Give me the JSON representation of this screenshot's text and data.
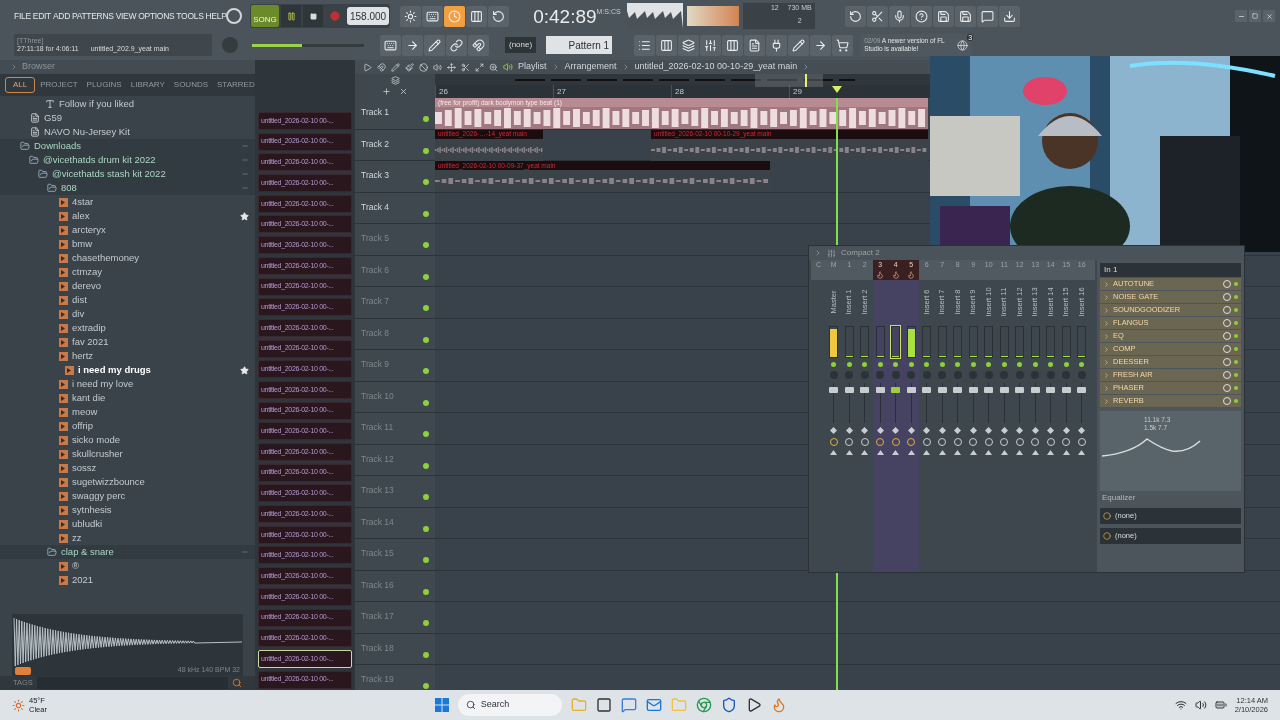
{
  "menu": [
    "FILE",
    "EDIT",
    "ADD",
    "PATTERNS",
    "VIEW",
    "OPTIONS",
    "TOOLS",
    "HELP"
  ],
  "hint": {
    "title": "[TThree]",
    "time": "27:11:18 for 4:06:11",
    "project": "untitled_202.9_yeat main"
  },
  "transport": {
    "mode": "SONG",
    "song_mode": true,
    "playing": true,
    "recording": false,
    "tempo": "158.000",
    "time": "0:42:89",
    "time_unit": "M:S:CS",
    "master_volume": {
      "level": 0.45
    }
  },
  "cpu": {
    "voices": "12",
    "memory": "730 MB",
    "poly": "2"
  },
  "pattern": {
    "snap": "(none)",
    "name": "Pattern 1"
  },
  "news": {
    "date": "02/09",
    "text": "A newer version of FL Studio is available!",
    "count": "3"
  },
  "browser": {
    "title": "Browser",
    "tabs": [
      {
        "label": "ALL",
        "selected": true
      },
      {
        "label": "PROJECT",
        "selected": false
      },
      {
        "label": "PLUGINS",
        "selected": false
      },
      {
        "label": "LIBRARY",
        "selected": false
      },
      {
        "label": "SOUNDS",
        "selected": false
      },
      {
        "label": "STARRED",
        "selected": false
      }
    ],
    "tree": [
      {
        "label": "Follow if you liked",
        "kind": "text"
      },
      {
        "label": "G59",
        "kind": "file"
      },
      {
        "label": "NAVO Nu-Jersey Kit",
        "kind": "file"
      },
      {
        "label": "Downloads",
        "kind": "folder",
        "expanded": true,
        "children": [
          {
            "label": "@vicethatds drum kit 2022",
            "kind": "folder",
            "expanded": true,
            "children": [
              {
                "label": "@vicethatds stash kit 2022",
                "kind": "folder",
                "expanded": true,
                "children": [
                  {
                    "label": "808",
                    "kind": "folder",
                    "expanded": true,
                    "children": [
                      {
                        "label": "4star",
                        "kind": "sample",
                        "selected": false,
                        "starred": false
                      },
                      {
                        "label": "alex",
                        "kind": "sample",
                        "selected": false,
                        "starred": true
                      },
                      {
                        "label": "arcteryx",
                        "kind": "sample",
                        "selected": false,
                        "starred": false
                      },
                      {
                        "label": "bmw",
                        "kind": "sample",
                        "selected": false,
                        "starred": false
                      },
                      {
                        "label": "chasethemoney",
                        "kind": "sample",
                        "selected": false,
                        "starred": false
                      },
                      {
                        "label": "ctmzay",
                        "kind": "sample",
                        "selected": false,
                        "starred": false
                      },
                      {
                        "label": "derevo",
                        "kind": "sample",
                        "selected": false,
                        "starred": false
                      },
                      {
                        "label": "dist",
                        "kind": "sample",
                        "selected": false,
                        "starred": false
                      },
                      {
                        "label": "div",
                        "kind": "sample",
                        "selected": false,
                        "starred": false
                      },
                      {
                        "label": "extradip",
                        "kind": "sample",
                        "selected": false,
                        "starred": false
                      },
                      {
                        "label": "fav 2021",
                        "kind": "sample",
                        "selected": false,
                        "starred": false
                      },
                      {
                        "label": "hertz",
                        "kind": "sample",
                        "selected": false,
                        "starred": false
                      },
                      {
                        "label": "i need my drugs",
                        "kind": "sample",
                        "selected": true,
                        "starred": true
                      },
                      {
                        "label": "i need my love",
                        "kind": "sample",
                        "selected": false,
                        "starred": false
                      },
                      {
                        "label": "kant die",
                        "kind": "sample",
                        "selected": false,
                        "starred": false
                      },
                      {
                        "label": "meow",
                        "kind": "sample",
                        "selected": false,
                        "starred": false
                      },
                      {
                        "label": "offrip",
                        "kind": "sample",
                        "selected": false,
                        "starred": false
                      },
                      {
                        "label": "sicko mode",
                        "kind": "sample",
                        "selected": false,
                        "starred": false
                      },
                      {
                        "label": "skullcrusher",
                        "kind": "sample",
                        "selected": false,
                        "starred": false
                      },
                      {
                        "label": "sossz",
                        "kind": "sample",
                        "selected": false,
                        "starred": false
                      },
                      {
                        "label": "sugetwizzbounce",
                        "kind": "sample",
                        "selected": false,
                        "starred": false
                      },
                      {
                        "label": "swaggy perc",
                        "kind": "sample",
                        "selected": false,
                        "starred": false
                      },
                      {
                        "label": "sytnhesis",
                        "kind": "sample",
                        "selected": false,
                        "starred": false
                      },
                      {
                        "label": "ubludki",
                        "kind": "sample",
                        "selected": false,
                        "starred": false
                      },
                      {
                        "label": "zz",
                        "kind": "sample",
                        "selected": false,
                        "starred": false
                      }
                    ]
                  },
                  {
                    "label": "clap & snare",
                    "kind": "folder",
                    "expanded": true,
                    "children": [
                      {
                        "label": "®",
                        "kind": "sample",
                        "selected": false,
                        "starred": false
                      },
                      {
                        "label": "2021",
                        "kind": "sample",
                        "selected": false,
                        "starred": false
                      }
                    ]
                  }
                ]
              }
            ]
          }
        ]
      }
    ],
    "sample_info": "48 kHz 140 BPM 32",
    "tags_label": "TAGS"
  },
  "clips": [
    {
      "label": "untitled_2026-02-10 00-...",
      "selected": false
    },
    {
      "label": "untitled_2026-02-10 00-...",
      "selected": false
    },
    {
      "label": "untitled_2026-02-10 00-...",
      "selected": false
    },
    {
      "label": "untitled_2026-02-10 00-...",
      "selected": false
    },
    {
      "label": "untitled_2026-02-10 00-...",
      "selected": false
    },
    {
      "label": "untitled_2026-02-10 00-...",
      "selected": false
    },
    {
      "label": "untitled_2026-02-10 00-...",
      "selected": false
    },
    {
      "label": "untitled_2026-02-10 00-...",
      "selected": false
    },
    {
      "label": "untitled_2026-02-10 00-...",
      "selected": false
    },
    {
      "label": "untitled_2026-02-10 00-...",
      "selected": false
    },
    {
      "label": "untitled_2026-02-10 00-...",
      "selected": false
    },
    {
      "label": "untitled_2026-02-10 00-...",
      "selected": false
    },
    {
      "label": "untitled_2026-02-10 00-...",
      "selected": false
    },
    {
      "label": "untitled_2026-02-10 00-...",
      "selected": false
    },
    {
      "label": "untitled_2026-02-10 00-...",
      "selected": false
    },
    {
      "label": "untitled_2026-02-10 00-...",
      "selected": false
    },
    {
      "label": "untitled_2026-02-10 00-...",
      "selected": false
    },
    {
      "label": "untitled_2026-02-10 00-...",
      "selected": false
    },
    {
      "label": "untitled_2026-02-10 00-...",
      "selected": false
    },
    {
      "label": "untitled_2026-02-10 00-...",
      "selected": false
    },
    {
      "label": "untitled_2026-02-10 00-...",
      "selected": false
    },
    {
      "label": "untitled_2026-02-10 00-...",
      "selected": false
    },
    {
      "label": "untitled_2026-02-10 00-...",
      "selected": false
    },
    {
      "label": "untitled_2026-02-10 00-...",
      "selected": false
    },
    {
      "label": "untitled_2026-02-10 00-...",
      "selected": false
    },
    {
      "label": "untitled_2026-02-10 00-...",
      "selected": false
    },
    {
      "label": "untitled_2026-02-10 00-...",
      "selected": true
    },
    {
      "label": "untitled_2026-02-10 00-...",
      "selected": false
    }
  ],
  "playlist": {
    "title": "Playlist",
    "section": "Arrangement",
    "project": "untitled_2026-02-10 00-10-29_yeat main",
    "ruler": [
      "26",
      "27",
      "28",
      "29"
    ],
    "tracks": [
      {
        "name": "Track 1",
        "clips": [
          {
            "label": "(free for profit) dark boolymon type beat (1)",
            "kind": "audio"
          }
        ]
      },
      {
        "name": "Track 2",
        "clips": [
          {
            "label": "untitled_2026-…-14_yeat main",
            "kind": "take"
          },
          {
            "label": "untitled_2026-02-10 00-10-29_yeat main",
            "kind": "take"
          }
        ]
      },
      {
        "name": "Track 3",
        "clips": [
          {
            "label": "untitled_2026-02-10 00-09-37_yeat main",
            "kind": "take"
          }
        ]
      },
      {
        "name": "Track 4"
      },
      {
        "name": "Track 5"
      },
      {
        "name": "Track 6"
      },
      {
        "name": "Track 7"
      },
      {
        "name": "Track 8"
      },
      {
        "name": "Track 9"
      },
      {
        "name": "Track 10"
      },
      {
        "name": "Track 11"
      },
      {
        "name": "Track 12"
      },
      {
        "name": "Track 13"
      },
      {
        "name": "Track 14"
      },
      {
        "name": "Track 15"
      },
      {
        "name": "Track 16"
      },
      {
        "name": "Track 17"
      },
      {
        "name": "Track 18"
      },
      {
        "name": "Track 19"
      }
    ]
  },
  "mixer": {
    "title": "Compact 2",
    "current_column": "C",
    "strips": [
      {
        "number": "M",
        "label": "Master",
        "selected": false,
        "level": 0.9
      },
      {
        "number": "1",
        "label": "Insert 1",
        "selected": false,
        "level": 0
      },
      {
        "number": "2",
        "label": "Insert 2",
        "selected": false,
        "level": 0
      },
      {
        "number": "3",
        "selected": true,
        "level": 0
      },
      {
        "number": "4",
        "selected": true,
        "level": 0
      },
      {
        "number": "5",
        "selected": true,
        "level": 0.9
      },
      {
        "number": "6",
        "label": "Insert 6",
        "selected": false,
        "level": 0
      },
      {
        "number": "7",
        "label": "Insert 7",
        "selected": false,
        "level": 0
      },
      {
        "number": "8",
        "label": "Insert 8",
        "selected": false,
        "level": 0
      },
      {
        "number": "9",
        "label": "Insert 9",
        "selected": false,
        "level": 0
      },
      {
        "number": "10",
        "label": "Insert 10",
        "selected": false,
        "level": 0
      },
      {
        "number": "11",
        "label": "Insert 11",
        "selected": false,
        "level": 0
      },
      {
        "number": "12",
        "label": "Insert 12",
        "selected": false,
        "level": 0
      },
      {
        "number": "13",
        "label": "Insert 13",
        "selected": false,
        "level": 0
      },
      {
        "number": "14",
        "label": "Insert 14",
        "selected": false,
        "level": 0
      },
      {
        "number": "15",
        "label": "Insert 15",
        "selected": false,
        "level": 0
      },
      {
        "number": "16",
        "label": "Insert 16",
        "selected": false,
        "level": 0
      }
    ],
    "input": "In 1",
    "slots": [
      "AUTOTUNE",
      "NOISE GATE",
      "SOUNDGOODIZER",
      "FLANGUS",
      "EQ",
      "COMP",
      "DEESSER",
      "FRESH AIR",
      "PHASER",
      "REVERB"
    ],
    "eq_readout": [
      "11.1k 7.3",
      "1.5k 7.7"
    ],
    "eq_label": "Equalizer",
    "outputs": [
      "(none)",
      "(none)"
    ]
  },
  "taskbar": {
    "temperature": "45°F",
    "weather": "Clear",
    "search": "Search",
    "time": "12:14 AM",
    "date": "2/10/2026"
  }
}
